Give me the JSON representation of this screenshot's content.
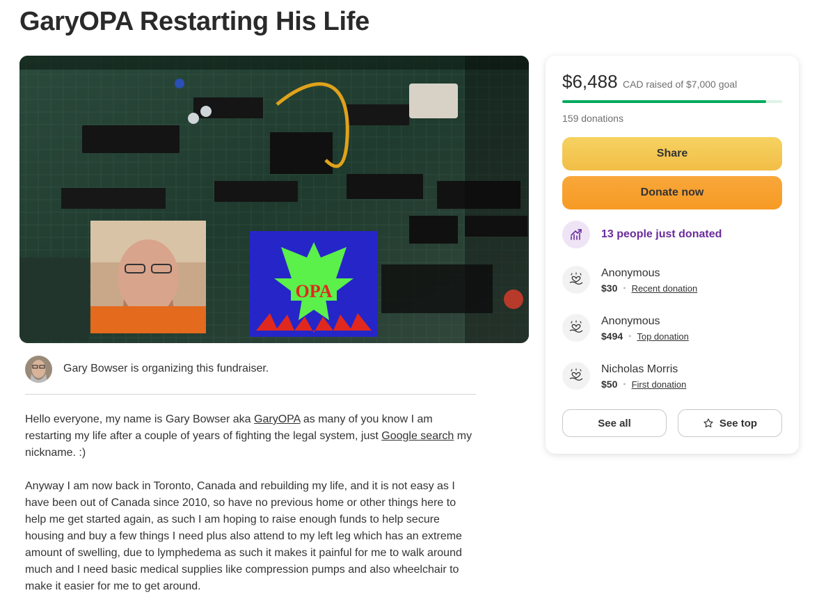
{
  "page": {
    "title": "GaryOPA Restarting His Life"
  },
  "organizer": {
    "text": "Gary Bowser is organizing this fundraiser."
  },
  "story": {
    "p1_before_link1": "Hello everyone, my name is Gary Bowser aka ",
    "p1_link1": "GaryOPA",
    "p1_mid": " as many of you know I am restarting my life after a couple of years of fighting the legal system, just ",
    "p1_link2": "Google search",
    "p1_after": " my nickname. :)",
    "p2": "Anyway I am now back in Toronto, Canada and rebuilding my life, and it is not easy as I have been out of Canada since 2010, so have no previous home or other things here to help me get started again, as such I am hoping to raise enough funds to help secure housing and buy a few things I need plus also attend to my left leg which has an extreme amount of swelling, due to lymphedema as such it makes it painful for me to walk around much and I need basic medical supplies like compression pumps and also wheelchair to make it easier for me to get around."
  },
  "hero": {
    "logo_text": "OPA"
  },
  "sidebar": {
    "raised_amount": "$6,488",
    "raised_goal": "CAD raised of $7,000 goal",
    "progress_fraction": 0.927,
    "donations_count": "159 donations",
    "share_label": "Share",
    "donate_label": "Donate now",
    "trend_text": "13 people just donated",
    "donors": [
      {
        "name": "Anonymous",
        "amount": "$30",
        "tag": "Recent donation"
      },
      {
        "name": "Anonymous",
        "amount": "$494",
        "tag": "Top donation"
      },
      {
        "name": "Nicholas Morris",
        "amount": "$50",
        "tag": "First donation"
      }
    ],
    "see_all_label": "See all",
    "see_top_label": "See top"
  },
  "colors": {
    "progress_fill": "#02a95c",
    "progress_track": "#dff3e8",
    "share_button": "#f2be46",
    "donate_button": "#f69a24",
    "trend_text": "#6a2b9c"
  },
  "icons": {
    "trend": "trending-up-icon",
    "donor": "heart-hand-icon",
    "see_top": "star-icon"
  }
}
